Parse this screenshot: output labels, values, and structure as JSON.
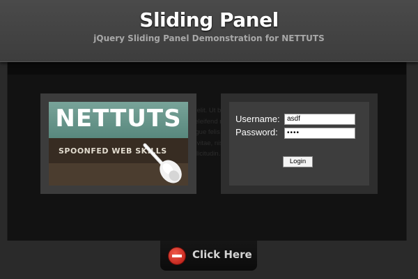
{
  "header": {
    "title": "Sliding Panel",
    "subtitle": "jQuery Sliding Panel Demonstration for NETTUTS"
  },
  "panel": {
    "background_text": "Lorem ipsum dolor sit amet, consectetur adipiscing elit. Ut blandit, velit ut scelerisque pharetra, sem odio lacinia erat, vel cursus elit est a arcu. Curabitur ligula leo, eleifend nec, porta vitae, consequat id, magna. Vivamus nec purus. Fusce eleifend, massa a gravida fringilla, augue felis ornare orci, nec ullamcorper turpis nulla sed est. Quisque sem arcu, porttitor ac, cursus sed, fringilla vitae, nisi. Num sollicitudin eros id ante. Nunc nisi augue, lobortis a, rhoncus quis, gravida nec, tortor. Sed sollicitudin. Nulla facilisi."
  },
  "logo": {
    "title": "NETTUTS",
    "tagline": "SPOONFED WEB SKILLS"
  },
  "login": {
    "username_label": "Username:",
    "username_value": "asdf",
    "password_label": "Password:",
    "password_value": "••••",
    "button_label": "Login"
  },
  "tab": {
    "label": "Click Here",
    "icon": "stop-icon",
    "icon_color": "#d62b1e"
  },
  "colors": {
    "header_bg": "#444444",
    "panel_bg": "#121212",
    "accent_teal": "#68988d"
  }
}
